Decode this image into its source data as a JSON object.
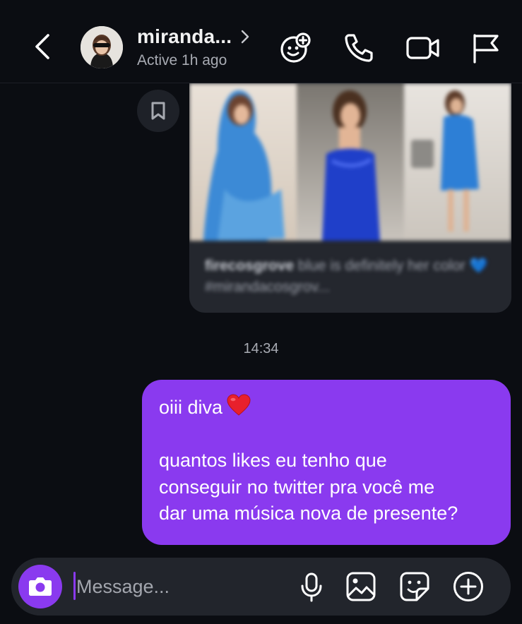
{
  "header": {
    "name": "miranda...",
    "status": "Active 1h ago",
    "icons": [
      "back-icon",
      "avatar",
      "chevron-right-icon",
      "effects-icon",
      "phone-icon",
      "video-icon",
      "flag-icon"
    ]
  },
  "shared_post": {
    "username": "firecosgrove",
    "caption": "blue is definitely her color 💙 #mirandacosgrov...",
    "save_icon": "bookmark-icon"
  },
  "timestamp": "14:34",
  "message": {
    "line1": "oiii diva",
    "line2": "quantos likes eu tenho que",
    "line3": "conseguir no twitter pra você me",
    "line4": "dar uma música nova de presente?",
    "emoji": "heart"
  },
  "composer": {
    "placeholder": "Message...",
    "icons": [
      "camera-icon",
      "microphone-icon",
      "gallery-icon",
      "sticker-icon",
      "plus-icon"
    ]
  },
  "colors": {
    "accent": "#8a3aef",
    "background": "#0b0d12",
    "surface": "#22252c"
  }
}
